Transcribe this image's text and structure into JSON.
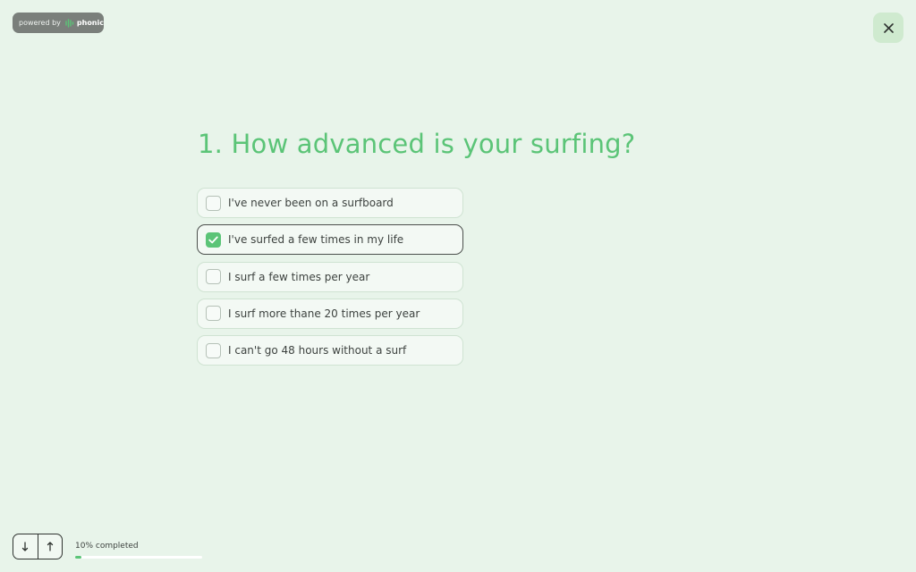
{
  "branding": {
    "powered_by_text": "powered by",
    "brand_name": "phonic",
    "brand_icon": "phonic-waveform-icon"
  },
  "header": {
    "close_icon": "close-icon"
  },
  "question": {
    "number": "1.",
    "title": "How advanced is your surfing?"
  },
  "options": [
    {
      "label": "I've never been on a surfboard",
      "selected": false
    },
    {
      "label": "I've surfed a few times in my life",
      "selected": true
    },
    {
      "label": "I surf a few times per year",
      "selected": false
    },
    {
      "label": "I surf more thane 20 times per year",
      "selected": false
    },
    {
      "label": "I can't go 48 hours without a surf",
      "selected": false
    }
  ],
  "footer": {
    "down_icon": "arrow-down-icon",
    "up_icon": "arrow-up-icon",
    "progress_text": "10% completed",
    "progress_fraction": 0.05
  },
  "colors": {
    "background": "#e8f4ea",
    "accent": "#5bc477",
    "option_bg": "#f3f9f4"
  }
}
